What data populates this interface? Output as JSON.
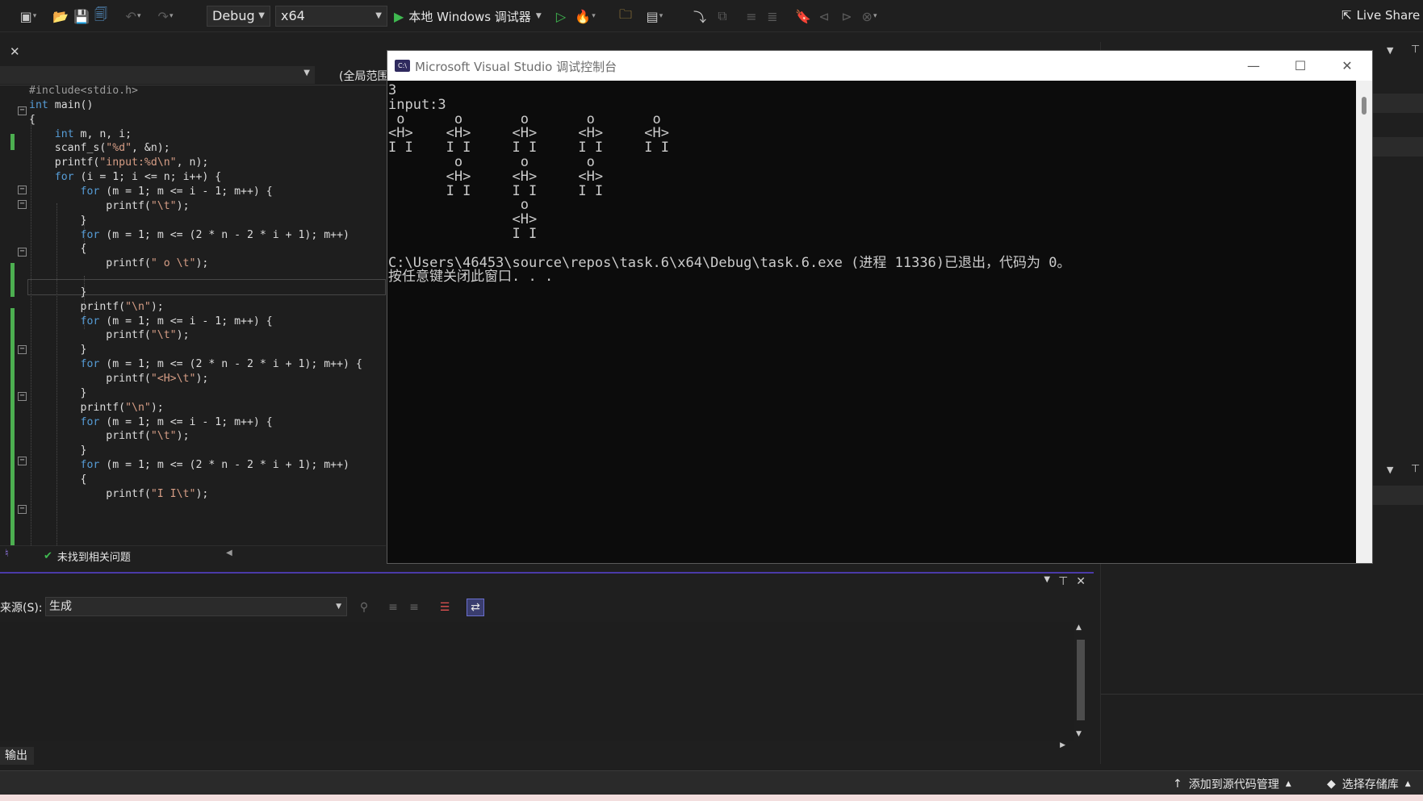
{
  "toolbar": {
    "config": "Debug",
    "platform": "x64",
    "run_label": "本地 Windows 调试器",
    "live_share": "Live Share"
  },
  "editor": {
    "nav_scope": "(全局范围)",
    "code_lines": [
      "#include<stdio.h>",
      "int main()",
      "{",
      "    int m, n, i;",
      "    scanf_s(\"%d\", &n);",
      "    printf(\"input:%d\\n\", n);",
      "    for (i = 1; i <= n; i++) {",
      "        for (m = 1; m <= i - 1; m++) {",
      "            printf(\"\\t\");",
      "        }",
      "        for (m = 1; m <= (2 * n - 2 * i + 1); m++)",
      "        {",
      "            printf(\" o \\t\");",
      "",
      "        }",
      "        printf(\"\\n\");",
      "        for (m = 1; m <= i - 1; m++) {",
      "            printf(\"\\t\");",
      "        }",
      "        for (m = 1; m <= (2 * n - 2 * i + 1); m++) {",
      "            printf(\"<H>\\t\");",
      "        }",
      "        printf(\"\\n\");",
      "        for (m = 1; m <= i - 1; m++) {",
      "            printf(\"\\t\");",
      "        }",
      "        for (m = 1; m <= (2 * n - 2 * i + 1); m++)",
      "        {",
      "            printf(\"I I\\t\");"
    ],
    "status_ok": "未找到相关问题"
  },
  "console": {
    "title": "Microsoft Visual Studio 调试控制台",
    "icon_text": "C:\\",
    "lines": [
      "3",
      "input:3",
      " o      o       o       o       o",
      "<H>    <H>     <H>     <H>     <H>",
      "I I    I I     I I     I I     I I",
      "        o       o       o",
      "       <H>     <H>     <H>",
      "       I I     I I     I I",
      "                o",
      "               <H>",
      "               I I",
      "",
      "C:\\Users\\46453\\source\\repos\\task.6\\x64\\Debug\\task.6.exe (进程 11336)已退出，代码为 0。",
      "按任意键关闭此窗口. . ."
    ]
  },
  "output": {
    "source_label": "来源(S):",
    "source_value": "生成",
    "tab_label": "输出"
  },
  "status_bar": {
    "git_label": "添加到源代码管理",
    "repo_label": "选择存储库"
  },
  "colors": {
    "accent": "#4a3aa8",
    "change_bar": "#4caf50",
    "keyword": "#569cd6",
    "string": "#d69d85"
  }
}
